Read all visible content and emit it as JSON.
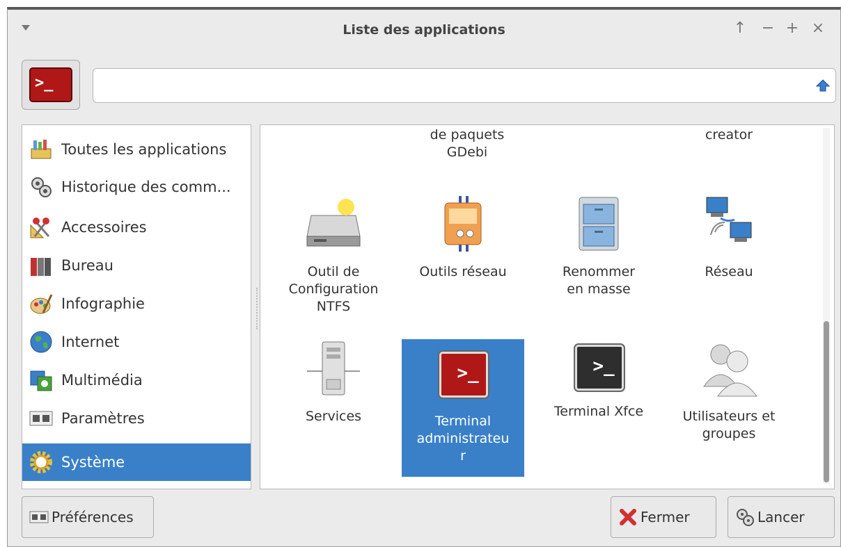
{
  "window": {
    "title": "Liste des applications",
    "controls": [
      "↑",
      "−",
      "+",
      "×"
    ]
  },
  "search": {
    "value": "",
    "placeholder": ""
  },
  "categories": [
    {
      "label": "Toutes les applications",
      "icon": "all-applications-icon"
    },
    {
      "label": "Historique des comm...",
      "icon": "gears-icon"
    },
    {
      "label": "Accessoires",
      "icon": "scissors-icon"
    },
    {
      "label": "Bureau",
      "icon": "binders-icon"
    },
    {
      "label": "Infographie",
      "icon": "palette-icon"
    },
    {
      "label": "Internet",
      "icon": "globe-icon"
    },
    {
      "label": "Multimédia",
      "icon": "multimedia-icon"
    },
    {
      "label": "Paramètres",
      "icon": "settings-panel-icon"
    },
    {
      "label": "Système",
      "icon": "system-gear-icon",
      "selected": true
    }
  ],
  "apps": [
    {
      "label": "de paquets\nGDebi"
    },
    {
      "label": "creator"
    },
    {
      "label": "Outil de\nConfiguration\nNTFS",
      "icon": "hard-drive-icon"
    },
    {
      "label": "Outils réseau",
      "icon": "network-tools-icon"
    },
    {
      "label": "Renommer\nen masse",
      "icon": "file-cabinet-icon"
    },
    {
      "label": "Réseau",
      "icon": "network-icon"
    },
    {
      "label": "Services",
      "icon": "server-icon"
    },
    {
      "label": "Terminal\nadministrateu\nr",
      "icon": "root-terminal-icon",
      "selected": true
    },
    {
      "label": "Terminal Xfce",
      "icon": "terminal-icon"
    },
    {
      "label": "Utilisateurs et\ngroupes",
      "icon": "users-icon"
    }
  ],
  "buttons": {
    "preferences": "Préférences",
    "close": "Fermer",
    "launch": "Lancer"
  },
  "colors": {
    "selection": "#3a80c8",
    "terminal_red": "#b01818"
  }
}
